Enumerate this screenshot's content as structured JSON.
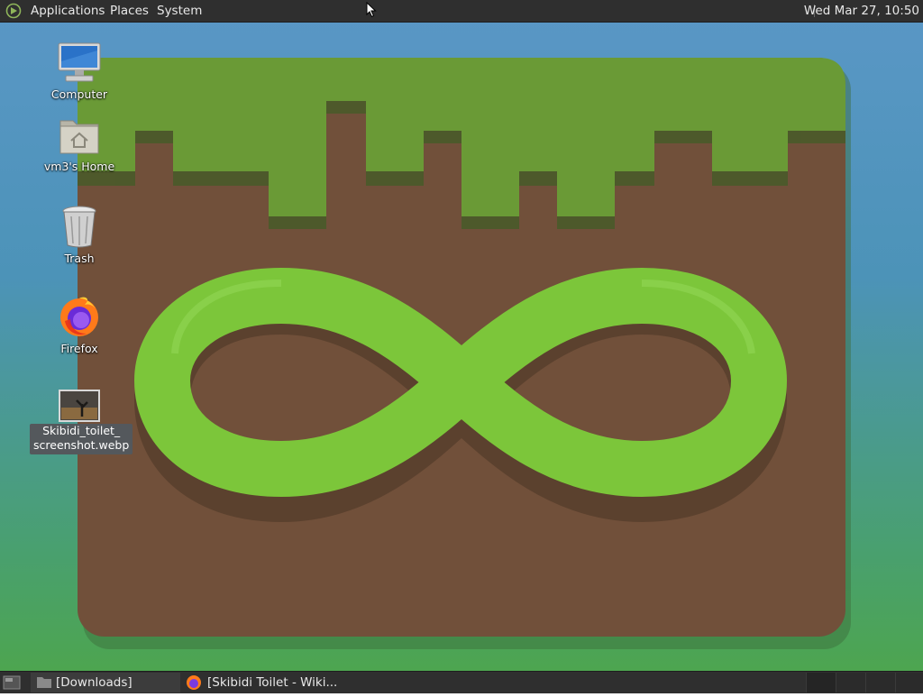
{
  "top_panel": {
    "menus": [
      "Applications",
      "Places",
      "System"
    ],
    "clock": "Wed Mar 27, 10:50"
  },
  "desktop_icons": [
    {
      "label": "Computer",
      "icon": "computer-icon"
    },
    {
      "label": "vm3's Home",
      "icon": "home-folder-icon"
    },
    {
      "label": "Trash",
      "icon": "trash-icon"
    },
    {
      "label": "Firefox",
      "icon": "firefox-icon"
    },
    {
      "label_line1": "Skibidi_toilet_",
      "label_line2": "screenshot.webp",
      "icon": "image-file-icon",
      "selected": true
    }
  ],
  "taskbar": {
    "tasks": [
      {
        "label": "[Downloads]",
        "icon": "folder-icon"
      },
      {
        "label": "[Skibidi Toilet - Wiki...",
        "icon": "firefox-icon"
      }
    ]
  },
  "colors": {
    "panel": "#2f2f2f",
    "grass": "#6a9a36",
    "dirt": "#71503a",
    "infinity": "#7cc63a"
  }
}
